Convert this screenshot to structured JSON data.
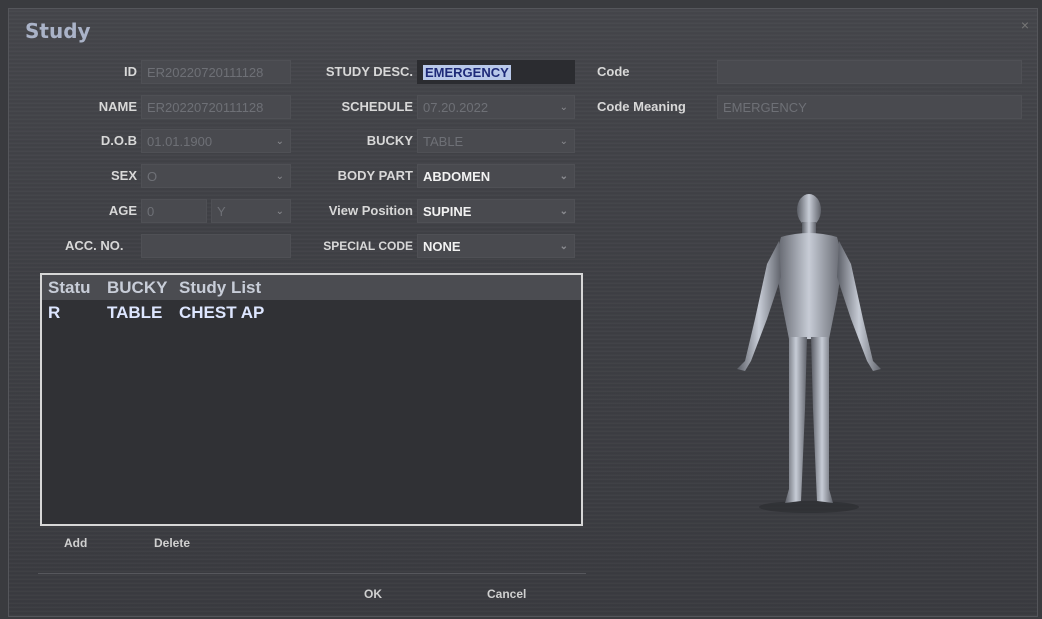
{
  "window": {
    "title": "Study",
    "close_glyph": "×"
  },
  "patient": {
    "id_label": "ID",
    "id_value": "ER20220720111128",
    "name_label": "NAME",
    "name_value": "ER20220720111128",
    "dob_label": "D.O.B",
    "dob_value": "01.01.1900",
    "sex_label": "SEX",
    "sex_value": "O",
    "age_label": "AGE",
    "age_value": "0",
    "age_unit": "Y",
    "acc_label": "ACC. NO.",
    "acc_value": ""
  },
  "study": {
    "desc_label": "STUDY DESC.",
    "desc_value": "EMERGENCY",
    "schedule_label": "SCHEDULE",
    "schedule_value": "07.20.2022",
    "bucky_label": "BUCKY",
    "bucky_value": "TABLE",
    "bodypart_label": "BODY PART",
    "bodypart_value": "ABDOMEN",
    "view_label": "View Position",
    "view_value": "SUPINE",
    "special_label": "SPECIAL CODE",
    "special_value": "NONE"
  },
  "code": {
    "code_label": "Code",
    "code_value": "",
    "meaning_label": "Code Meaning",
    "meaning_value": "EMERGENCY"
  },
  "study_list": {
    "headers": [
      "Statu",
      "BUCKY",
      "Study List"
    ],
    "rows": [
      {
        "status": "R",
        "bucky": "TABLE",
        "study": "CHEST AP"
      }
    ]
  },
  "buttons": {
    "add": "Add",
    "delete": "Delete",
    "ok": "OK",
    "cancel": "Cancel"
  },
  "colors": {
    "accent_text": "#b9c9ea",
    "list_border": "#d7d7d7",
    "background": "#3e3f44"
  },
  "icons": {
    "dropdown": "chevron-down-icon",
    "body": "human-body-icon"
  }
}
